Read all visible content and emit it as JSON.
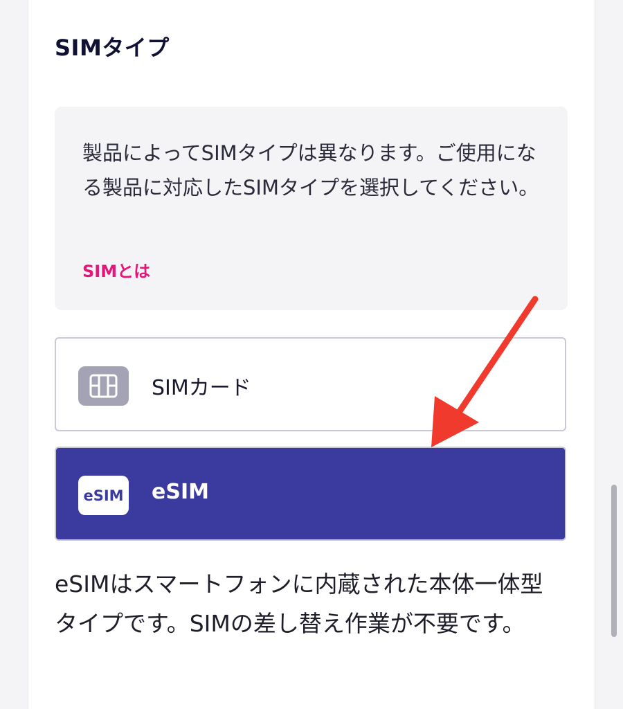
{
  "section_title": "SIMタイプ",
  "info": {
    "text": "製品によってSIMタイプは異なります。ご使用になる製品に対応したSIMタイプを選択してください。",
    "link": "SIMとは"
  },
  "options": [
    {
      "label": "SIMカード",
      "icon": "sim-card-icon",
      "selected": false
    },
    {
      "label": "eSIM",
      "icon_text": "eSIM",
      "icon": "esim-icon",
      "selected": true
    }
  ],
  "description": "eSIMはスマートフォンに内蔵された本体一体型タイプです。SIMの差し替え作業が不要です。",
  "colors": {
    "accent": "#3b3a9e",
    "link": "#e6157a",
    "annotation_arrow": "#f03a2e"
  }
}
